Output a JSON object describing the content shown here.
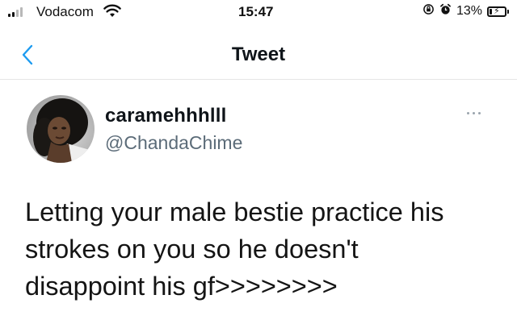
{
  "status_bar": {
    "carrier": "Vodacom",
    "time": "15:47",
    "battery_percent": "13%",
    "signal_bars_filled": 2,
    "signal_bars_total": 4
  },
  "nav": {
    "title": "Tweet"
  },
  "tweet": {
    "display_name": "caramehhhlll",
    "handle": "@ChandaChime",
    "text_lines": [
      "Letting your male bestie practice his",
      "strokes on you so he doesn't",
      "disappoint his gf>>>>>>>>"
    ]
  },
  "colors": {
    "text": "#141414",
    "handle": "#5b6b78",
    "accent": "#1d9bf0",
    "divider": "#e6e6e6"
  },
  "icons": {
    "back": "chevron-left-icon",
    "more": "more-horizontal-icon",
    "wifi": "wifi-icon",
    "battery": "battery-charging-icon",
    "lock": "rotation-lock-icon",
    "alarm": "alarm-icon"
  }
}
